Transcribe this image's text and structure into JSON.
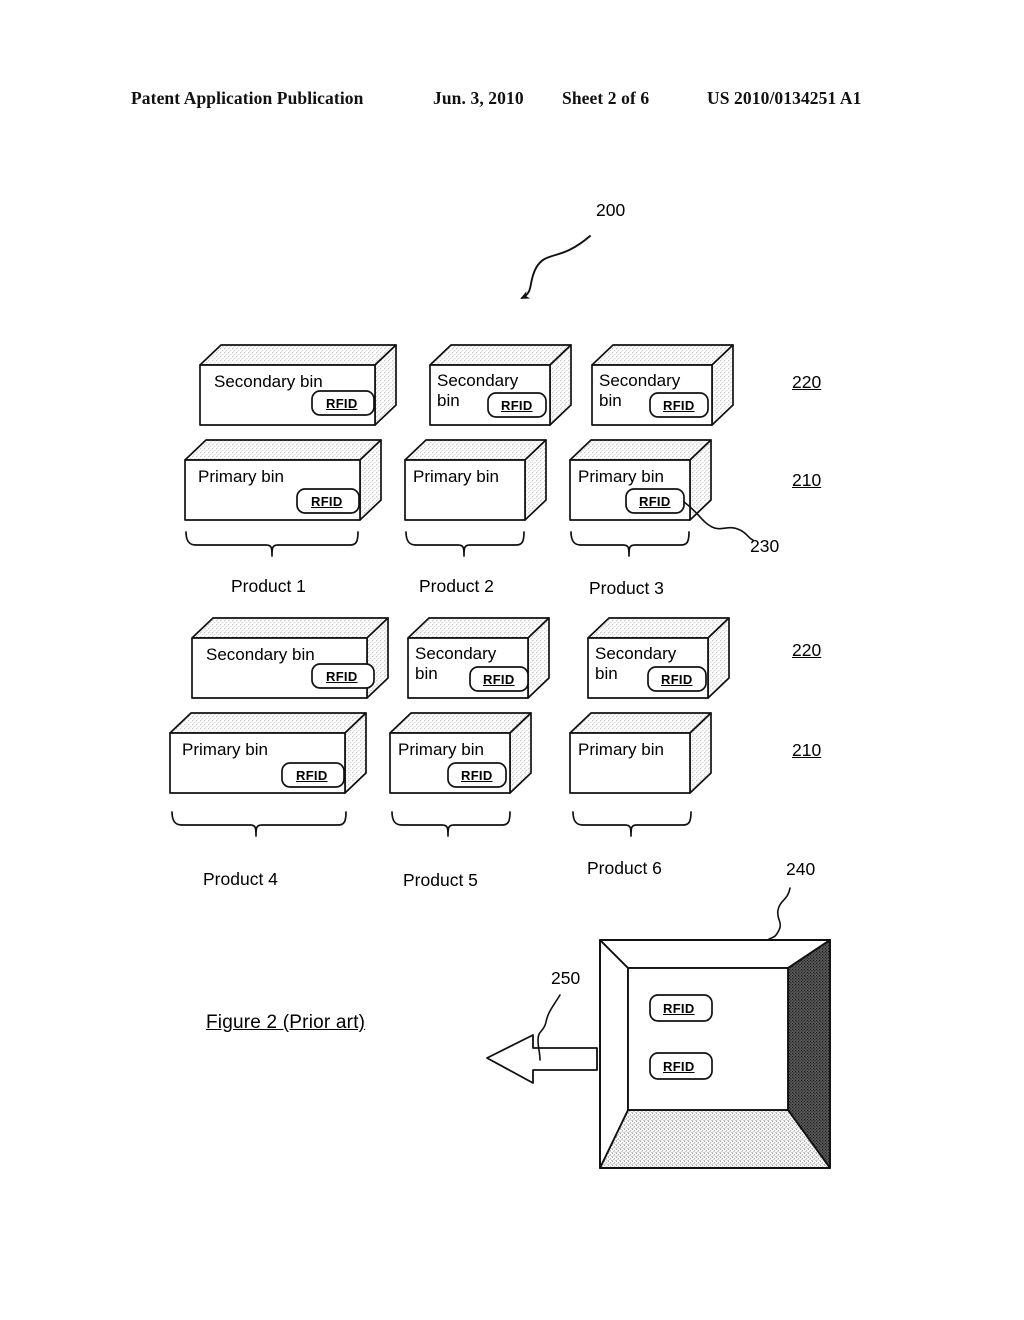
{
  "header": {
    "publication": "Patent Application Publication",
    "date": "Jun. 3, 2010",
    "sheet": "Sheet 2 of 6",
    "patent_number": "US 2010/0134251 A1"
  },
  "figure": {
    "caption": "Figure 2 (Prior art)",
    "system_ref": "200",
    "rfid_tag_label": "RFID",
    "rows": [
      {
        "row_id": "row-1",
        "secondary_ref": "220",
        "primary_ref": "210",
        "tag_callout_ref": "230",
        "groups": [
          {
            "product_label": "Product 1",
            "secondary": {
              "label": "Secondary bin",
              "two_line": false,
              "has_rfid": true
            },
            "primary": {
              "label": "Primary bin",
              "has_rfid": true
            }
          },
          {
            "product_label": "Product 2",
            "secondary": {
              "label": "Secondary bin",
              "two_line": true,
              "has_rfid": true
            },
            "primary": {
              "label": "Primary bin",
              "has_rfid": false
            }
          },
          {
            "product_label": "Product 3",
            "secondary": {
              "label": "Secondary bin",
              "two_line": true,
              "has_rfid": true
            },
            "primary": {
              "label": "Primary bin",
              "has_rfid": true
            }
          }
        ]
      },
      {
        "row_id": "row-2",
        "secondary_ref": "220",
        "primary_ref": "210",
        "groups": [
          {
            "product_label": "Product 4",
            "secondary": {
              "label": "Secondary bin",
              "two_line": false,
              "has_rfid": true
            },
            "primary": {
              "label": "Primary bin",
              "has_rfid": true
            }
          },
          {
            "product_label": "Product 5",
            "secondary": {
              "label": "Secondary bin",
              "two_line": true,
              "has_rfid": true
            },
            "primary": {
              "label": "Primary bin",
              "has_rfid": true
            }
          },
          {
            "product_label": "Product 6",
            "secondary": {
              "label": "Secondary bin",
              "two_line": true,
              "has_rfid": true
            },
            "primary": {
              "label": "Primary bin",
              "has_rfid": false
            }
          }
        ]
      }
    ],
    "container": {
      "ref": "240",
      "arrow_ref": "250",
      "tags": [
        "RFID",
        "RFID"
      ]
    }
  }
}
